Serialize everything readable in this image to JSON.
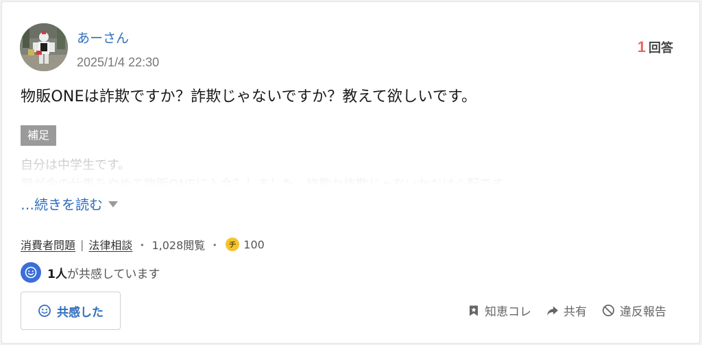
{
  "question": {
    "user_name": "あーさん",
    "timestamp": "2025/1/4 22:30",
    "answer_count": "1",
    "answer_label": "回答",
    "title": "物販ONEは詐欺ですか？詐欺じゃないですか？教えて欲しいです。",
    "supplement_label": "補足",
    "supplement_lines": [
      "自分は中学生です。",
      "親が今の仕事をやめて物販ONEに入会？しました。詐欺か詐欺じゃないかだけ心配です。"
    ],
    "read_more": "…続きを読む"
  },
  "meta": {
    "category_1": "消費者問題",
    "divider": "|",
    "category_2": "法律相談",
    "views": "1,028閲覧",
    "coin_glyph": "チ",
    "coins": "100"
  },
  "empathy": {
    "count": "1人",
    "text": "が共感しています",
    "button_label": "共感した"
  },
  "actions": {
    "chiekore": "知恵コレ",
    "share": "共有",
    "report": "違反報告"
  },
  "colors": {
    "link_blue": "#2f6dbd",
    "answer_red": "#e66a6a",
    "empathy_blue": "#3b6ed8",
    "coin_yellow": "#f4c430"
  }
}
